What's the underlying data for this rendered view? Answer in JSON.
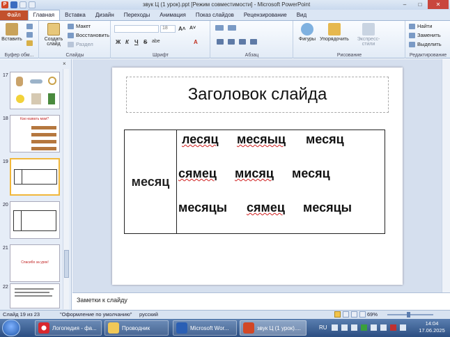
{
  "window": {
    "title": "звук Ц (1 урок).ppt [Режим совместимости] - Microsoft PowerPoint",
    "qat_logo": "P",
    "controls": {
      "minimize": "–",
      "maximize": "□",
      "close": "✕"
    }
  },
  "tabs": [
    "Файл",
    "Главная",
    "Вставка",
    "Дизайн",
    "Переходы",
    "Анимация",
    "Показ слайдов",
    "Рецензирование",
    "Вид"
  ],
  "ribbon": {
    "clipboard": {
      "paste": "Вставить",
      "label": "Буфер обм..."
    },
    "slides": {
      "create": "Создать слайд",
      "layout": "Макет",
      "reset": "Восстановить",
      "section": "Раздел",
      "label": "Слайды"
    },
    "font": {
      "size": "18",
      "bold": "Ж",
      "italic": "К",
      "underline": "Ч",
      "strike": "S",
      "shadow": "abe",
      "label": "Шрифт"
    },
    "paragraph": {
      "label": "Абзац"
    },
    "drawing": {
      "shapes": "Фигуры",
      "arrange": "Упорядочить",
      "quick_styles": "Экспресс-стили",
      "label": "Рисование"
    },
    "editing": {
      "find": "Найти",
      "replace": "Заменить",
      "select": "Выделить",
      "label": "Редактирование"
    }
  },
  "slides_pane": {
    "close": "×",
    "thumbnails": [
      {
        "num": "17",
        "caption": ""
      },
      {
        "num": "18",
        "caption": "Как назвать мам?"
      },
      {
        "num": "19",
        "caption": "",
        "selected": true
      },
      {
        "num": "20",
        "caption": ""
      },
      {
        "num": "21",
        "caption": "Спасибо за урок!"
      },
      {
        "num": "22",
        "caption": ""
      }
    ]
  },
  "slide": {
    "title": "Заголовок слайда",
    "table": {
      "left_cell": "месяц",
      "rows": [
        [
          "лесяц",
          "месяыц",
          "месяц"
        ],
        [
          "сямец",
          "мисяц",
          "месяц"
        ],
        [
          "месяцы",
          "сямец",
          "месяцы"
        ]
      ]
    }
  },
  "notes": {
    "placeholder": "Заметки к слайду"
  },
  "status": {
    "slide": "Слайд 19 из 23",
    "theme": "\"Оформление по умолчанию\"",
    "lang": "русский",
    "zoom": "69%"
  },
  "taskbar": {
    "items": [
      "Логопедия - фа...",
      "Проводник",
      "Microsoft Wor...",
      "звук Ц (1 урок)...."
    ],
    "lang": "RU",
    "time": "14:04",
    "date": "17.06.2025"
  }
}
